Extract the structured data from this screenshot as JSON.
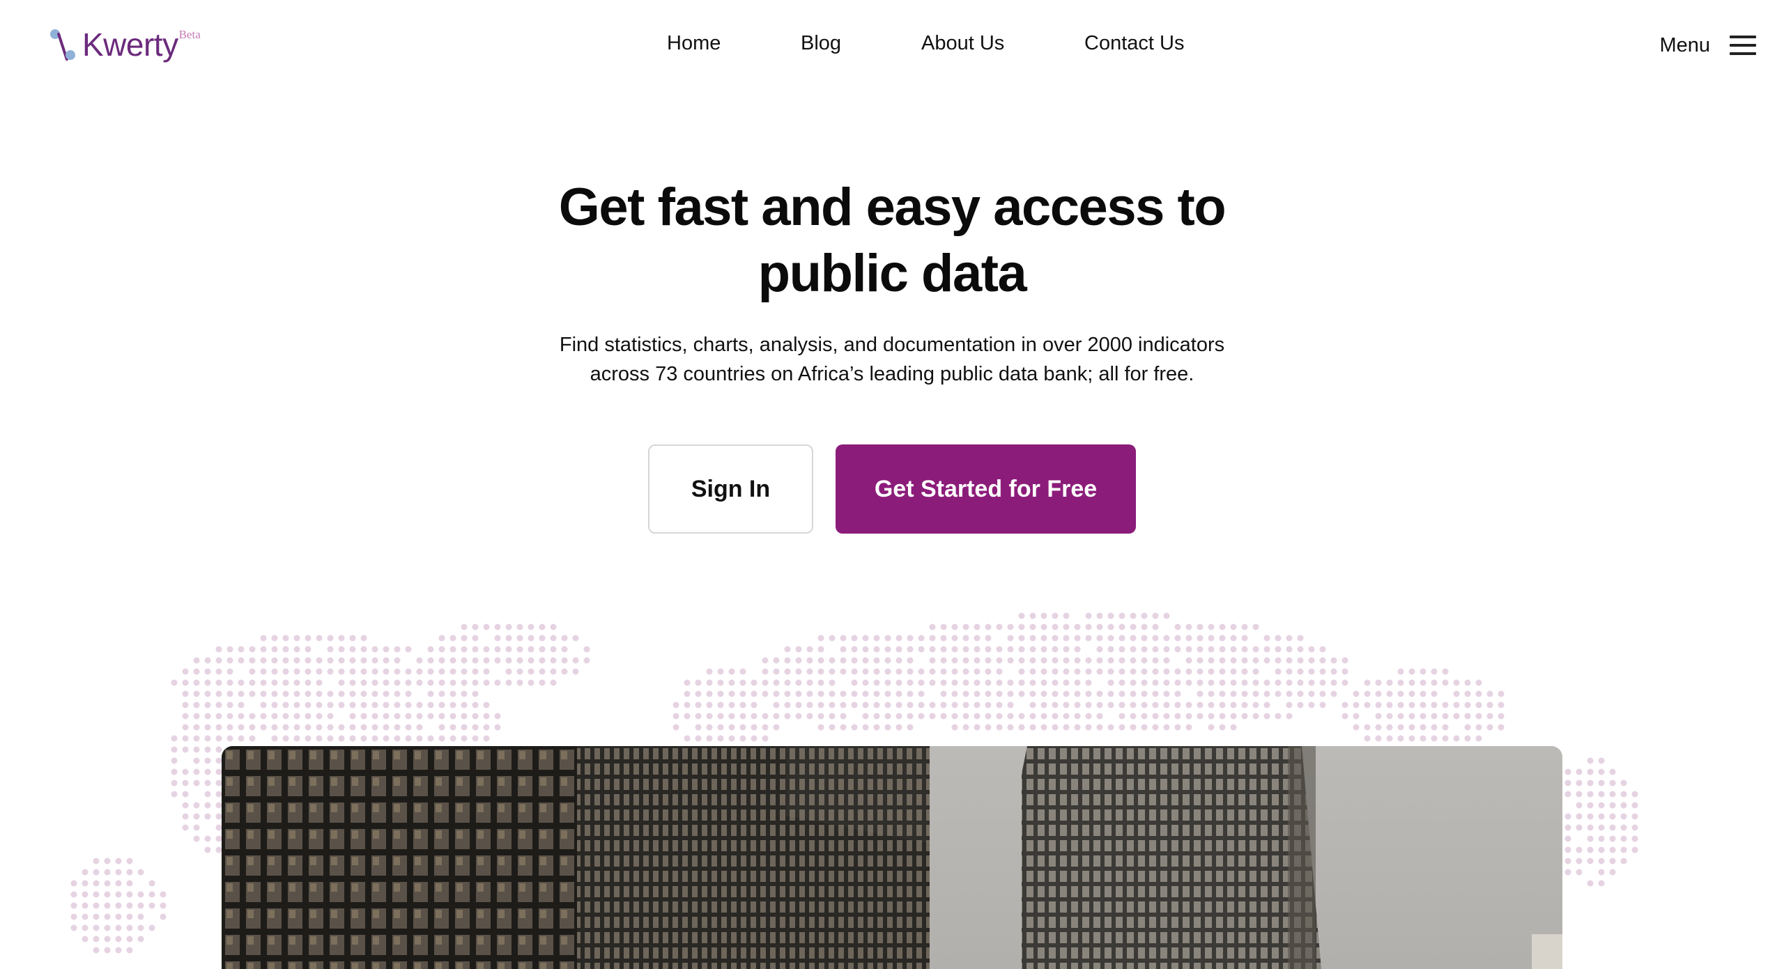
{
  "logo": {
    "wordmark": "Kwerty",
    "badge": "Beta"
  },
  "nav": {
    "items": [
      {
        "label": "Home"
      },
      {
        "label": "Blog"
      },
      {
        "label": "About Us"
      },
      {
        "label": "Contact Us"
      }
    ],
    "menu_label": "Menu",
    "menu_icon": "hamburger-icon"
  },
  "hero": {
    "title_line1": "Get fast and easy access to",
    "title_line2": "public data",
    "subtitle_line1": "Find statistics, charts, analysis, and documentation in over 2000 indicators",
    "subtitle_line2": "across 73 countries on Africa’s leading public data bank; all for free.",
    "signin_label": "Sign In",
    "cta_label": "Get Started for Free"
  },
  "colors": {
    "brand_purple": "#8c1c7a",
    "logo_purple": "#6b2a7c",
    "logo_blue": "#8fb1d8",
    "map_dots": "#e6d3e2"
  }
}
